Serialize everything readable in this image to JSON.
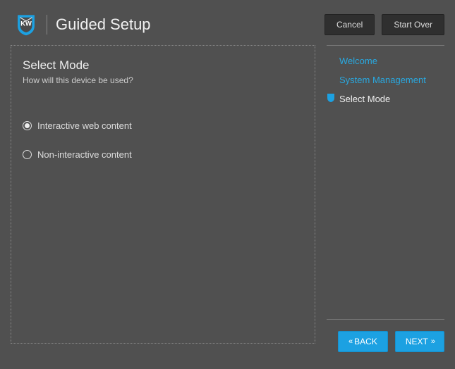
{
  "header": {
    "title": "Guided Setup",
    "cancel_label": "Cancel",
    "startover_label": "Start Over"
  },
  "panel": {
    "title": "Select Mode",
    "subtitle": "How will this device be used?",
    "options": [
      {
        "label": "Interactive web content",
        "selected": true
      },
      {
        "label": "Non-interactive content",
        "selected": false
      }
    ]
  },
  "steps": [
    {
      "label": "Welcome",
      "state": "completed"
    },
    {
      "label": "System Management",
      "state": "completed"
    },
    {
      "label": "Select Mode",
      "state": "current"
    }
  ],
  "nav": {
    "back_label": "BACK",
    "next_label": "NEXT"
  },
  "colors": {
    "accent": "#1ca1e2"
  }
}
